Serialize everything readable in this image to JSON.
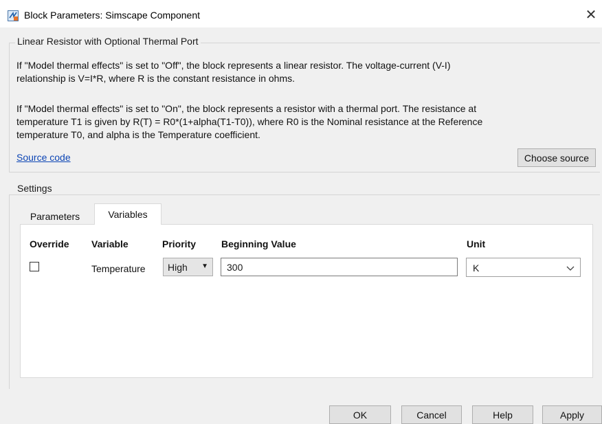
{
  "window": {
    "title": "Block Parameters: Simscape Component",
    "close_glyph": "✕"
  },
  "description": {
    "group_title": "Linear Resistor with Optional Thermal Port",
    "para1_line1": "If \"Model thermal effects\" is set to \"Off\", the block represents a linear resistor. The voltage-current (V-I)",
    "para1_line2": "relationship is V=I*R, where R is the constant resistance in ohms.",
    "para2_line1": "If \"Model thermal effects\" is set to \"On\", the block represents a resistor with a thermal port. The resistance at",
    "para2_line2": "temperature T1 is given by R(T) = R0*(1+alpha(T1-T0)), where R0 is the Nominal resistance at the Reference",
    "para2_line3": "temperature T0, and alpha is the Temperature coefficient.",
    "source_link": "Source code",
    "choose_source_button": "Choose source"
  },
  "settings": {
    "group_title": "Settings",
    "tabs": [
      {
        "label": "Parameters",
        "active": false
      },
      {
        "label": "Variables",
        "active": true
      }
    ],
    "table": {
      "headers": [
        "Override",
        "Variable",
        "Priority",
        "Beginning Value",
        "Unit"
      ],
      "rows": [
        {
          "override_checked": false,
          "variable": "Temperature",
          "priority": "High",
          "beginning_value": "300",
          "unit": "K"
        }
      ]
    }
  },
  "footer": {
    "ok": "OK",
    "cancel": "Cancel",
    "help": "Help",
    "apply": "Apply"
  },
  "icons": {
    "app": "simulink-block-icon",
    "close": "close-icon",
    "priority_dropdown": "caret-down-icon",
    "unit_dropdown": "chevron-down-icon"
  }
}
